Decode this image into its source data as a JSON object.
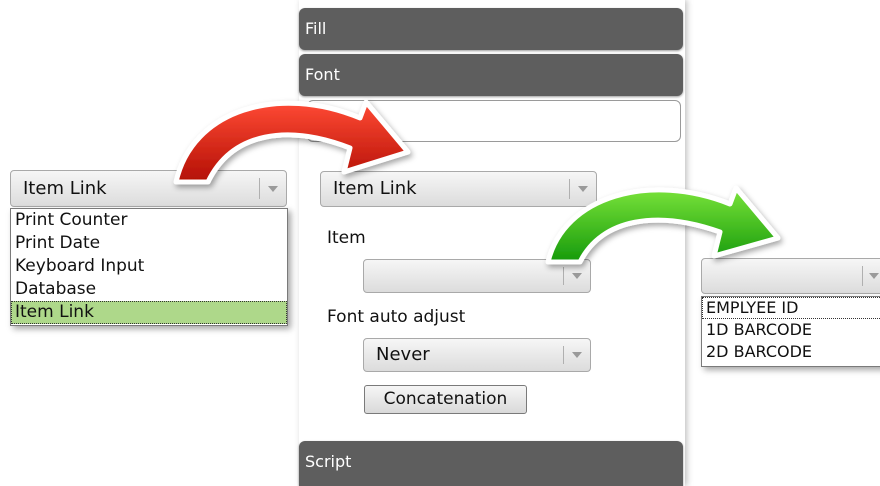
{
  "center_panel": {
    "sections": {
      "fill": "Fill",
      "font": "Font",
      "script": "Script"
    },
    "source_dropdown": {
      "selected": "Item Link"
    },
    "item_label": "Item",
    "item_dropdown": {
      "selected": ""
    },
    "font_auto_adjust_label": "Font auto adjust",
    "font_auto_adjust_dropdown": {
      "selected": "Never"
    },
    "concatenation_button": "Concatenation"
  },
  "left_dropdown": {
    "selected": "Item Link",
    "options": [
      "Print Counter",
      "Print Date",
      "Keyboard Input",
      "Database",
      "Item Link"
    ],
    "highlighted_index": 4,
    "highlight_color": "#aed88a"
  },
  "right_dropdown": {
    "selected": "",
    "options": [
      "EMPLYEE ID",
      "1D BARCODE",
      "2D BARCODE"
    ]
  },
  "arrows": [
    {
      "color": "#d21f0f",
      "from": "left_dropdown",
      "to": "center_panel"
    },
    {
      "color": "#2fb80f",
      "from": "center_panel",
      "to": "right_dropdown"
    }
  ]
}
